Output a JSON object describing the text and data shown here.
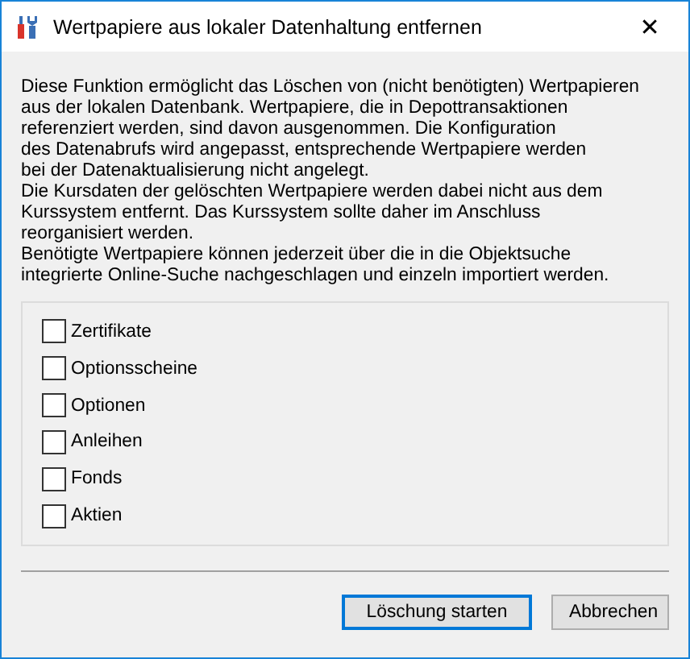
{
  "window": {
    "title": "Wertpapiere aus lokaler Datenhaltung entfernen",
    "close": "✕"
  },
  "description": [
    "Diese Funktion ermöglicht das Löschen von (nicht benötigten) Wertpapieren",
    "aus der lokalen Datenbank. Wertpapiere, die in Depottransaktionen",
    "referenziert werden, sind davon ausgenommen. Die Konfiguration",
    "des Datenabrufs wird angepasst, entsprechende Wertpapiere werden",
    "bei der Datenaktualisierung nicht angelegt.",
    "Die Kursdaten der gelöschten Wertpapiere werden dabei nicht aus dem",
    "Kurssystem entfernt. Das Kurssystem sollte daher im Anschluss",
    "reorganisiert werden.",
    "Benötigte Wertpapiere können jederzeit über die in die Objektsuche",
    "integrierte Online-Suche nachgeschlagen und einzeln importiert werden."
  ],
  "options": [
    {
      "label": "Zertifikate",
      "checked": false
    },
    {
      "label": "Optionsscheine",
      "checked": false
    },
    {
      "label": "Optionen",
      "checked": false
    },
    {
      "label": "Anleihen",
      "checked": false
    },
    {
      "label": "Fonds",
      "checked": false
    },
    {
      "label": "Aktien",
      "checked": false
    }
  ],
  "buttons": [
    {
      "label": "Löschung starten",
      "default": true
    },
    {
      "label": "Abbrechen",
      "default": false
    }
  ]
}
